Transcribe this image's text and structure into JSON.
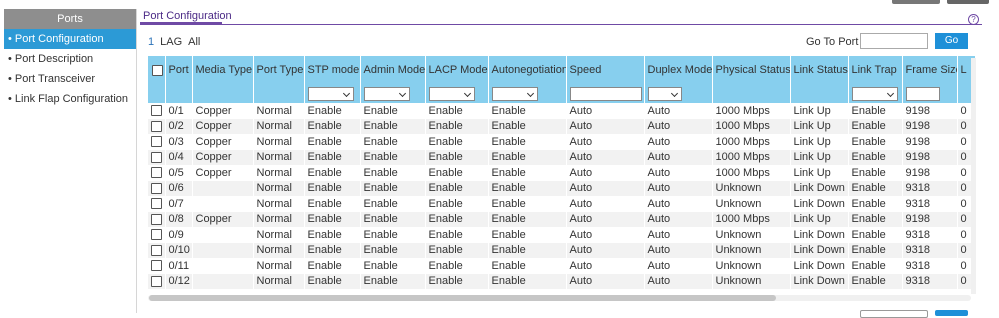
{
  "sidebar": {
    "heading": "Ports",
    "items": [
      {
        "label": "Port Configuration"
      },
      {
        "label": "Port Description"
      },
      {
        "label": "Port Transceiver"
      },
      {
        "label": "Link Flap Configuration"
      }
    ]
  },
  "page": {
    "title": "Port Configuration",
    "help_glyph": "?"
  },
  "tabs": {
    "lag_prefix": "1",
    "lag": "LAG",
    "all": "All"
  },
  "goto": {
    "label": "Go To Port",
    "value": "",
    "button": "Go"
  },
  "table": {
    "columns": [
      "Port",
      "Media Type",
      "Port Type",
      "STP mode",
      "Admin Mode",
      "LACP Mode",
      "Autonegotiation",
      "Speed",
      "Duplex Mode",
      "Physical Status",
      "Link Status",
      "Link Trap",
      "Frame Size",
      "L"
    ],
    "rows": [
      [
        "0/1",
        "Copper",
        "Normal",
        "Enable",
        "Enable",
        "Enable",
        "Enable",
        "Auto",
        "Auto",
        "1000 Mbps",
        "Link Up",
        "Enable",
        "9198",
        "0"
      ],
      [
        "0/2",
        "Copper",
        "Normal",
        "Enable",
        "Enable",
        "Enable",
        "Enable",
        "Auto",
        "Auto",
        "1000 Mbps",
        "Link Up",
        "Enable",
        "9198",
        "0"
      ],
      [
        "0/3",
        "Copper",
        "Normal",
        "Enable",
        "Enable",
        "Enable",
        "Enable",
        "Auto",
        "Auto",
        "1000 Mbps",
        "Link Up",
        "Enable",
        "9198",
        "0"
      ],
      [
        "0/4",
        "Copper",
        "Normal",
        "Enable",
        "Enable",
        "Enable",
        "Enable",
        "Auto",
        "Auto",
        "1000 Mbps",
        "Link Up",
        "Enable",
        "9198",
        "0"
      ],
      [
        "0/5",
        "Copper",
        "Normal",
        "Enable",
        "Enable",
        "Enable",
        "Enable",
        "Auto",
        "Auto",
        "1000 Mbps",
        "Link Up",
        "Enable",
        "9198",
        "0"
      ],
      [
        "0/6",
        "",
        "Normal",
        "Enable",
        "Enable",
        "Enable",
        "Enable",
        "Auto",
        "Auto",
        "Unknown",
        "Link Down",
        "Enable",
        "9318",
        "0"
      ],
      [
        "0/7",
        "",
        "Normal",
        "Enable",
        "Enable",
        "Enable",
        "Enable",
        "Auto",
        "Auto",
        "Unknown",
        "Link Down",
        "Enable",
        "9318",
        "0"
      ],
      [
        "0/8",
        "Copper",
        "Normal",
        "Enable",
        "Enable",
        "Enable",
        "Enable",
        "Auto",
        "Auto",
        "1000 Mbps",
        "Link Up",
        "Enable",
        "9198",
        "0"
      ],
      [
        "0/9",
        "",
        "Normal",
        "Enable",
        "Enable",
        "Enable",
        "Enable",
        "Auto",
        "Auto",
        "Unknown",
        "Link Down",
        "Enable",
        "9318",
        "0"
      ],
      [
        "0/10",
        "",
        "Normal",
        "Enable",
        "Enable",
        "Enable",
        "Enable",
        "Auto",
        "Auto",
        "Unknown",
        "Link Down",
        "Enable",
        "9318",
        "0"
      ],
      [
        "0/11",
        "",
        "Normal",
        "Enable",
        "Enable",
        "Enable",
        "Enable",
        "Auto",
        "Auto",
        "Unknown",
        "Link Down",
        "Enable",
        "9318",
        "0"
      ],
      [
        "0/12",
        "",
        "Normal",
        "Enable",
        "Enable",
        "Enable",
        "Enable",
        "Auto",
        "Auto",
        "Unknown",
        "Link Down",
        "Enable",
        "9318",
        "0"
      ]
    ]
  },
  "colors": {
    "accent": "#2c9ad6",
    "header": "#87cfee",
    "title": "#6f4aa5"
  }
}
